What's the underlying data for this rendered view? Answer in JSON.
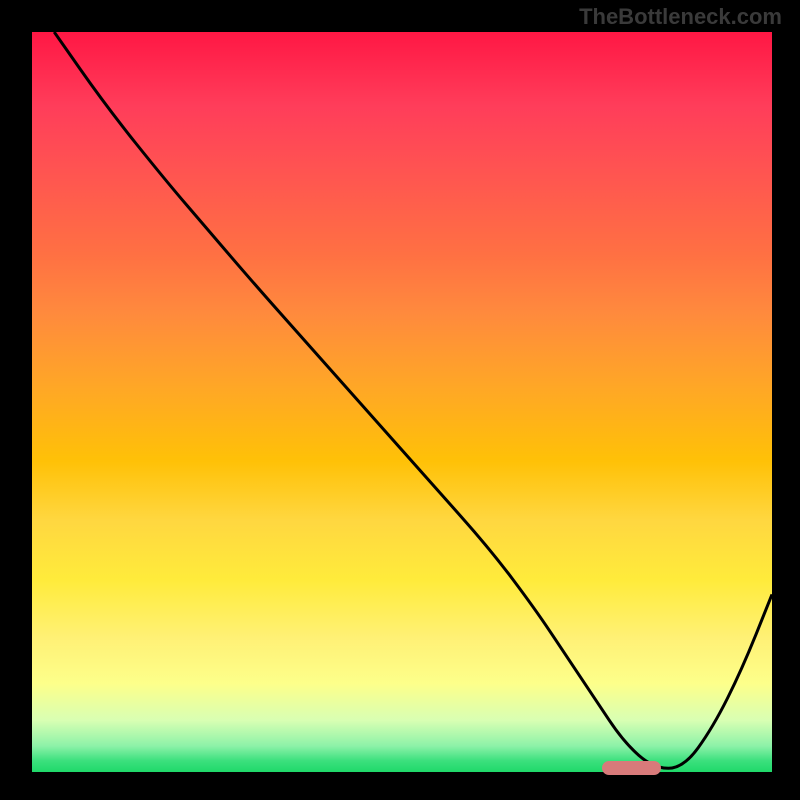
{
  "watermark": "TheBottleneck.com",
  "chart_data": {
    "type": "line",
    "title": "",
    "xlabel": "",
    "ylabel": "",
    "xlim": [
      0,
      100
    ],
    "ylim": [
      0,
      100
    ],
    "grid": false,
    "legend": false,
    "background": "gradient-red-to-green",
    "series": [
      {
        "name": "bottleneck-curve",
        "x": [
          3,
          10,
          18,
          24,
          30,
          38,
          46,
          54,
          62,
          68,
          72,
          76,
          80,
          84,
          88,
          92,
          96,
          100
        ],
        "values": [
          100,
          90,
          80,
          73,
          66,
          57,
          48,
          39,
          30,
          22,
          16,
          10,
          4,
          0.5,
          0.5,
          6,
          14,
          24
        ]
      }
    ],
    "marker": {
      "name": "optimal-range",
      "x_start": 77,
      "x_end": 85,
      "y": 0.5,
      "color": "#d87a7a"
    },
    "colors": {
      "top": "#ff1744",
      "mid": "#ffd740",
      "bottom": "#1fd96a",
      "curve": "#000000",
      "frame": "#000000"
    }
  }
}
